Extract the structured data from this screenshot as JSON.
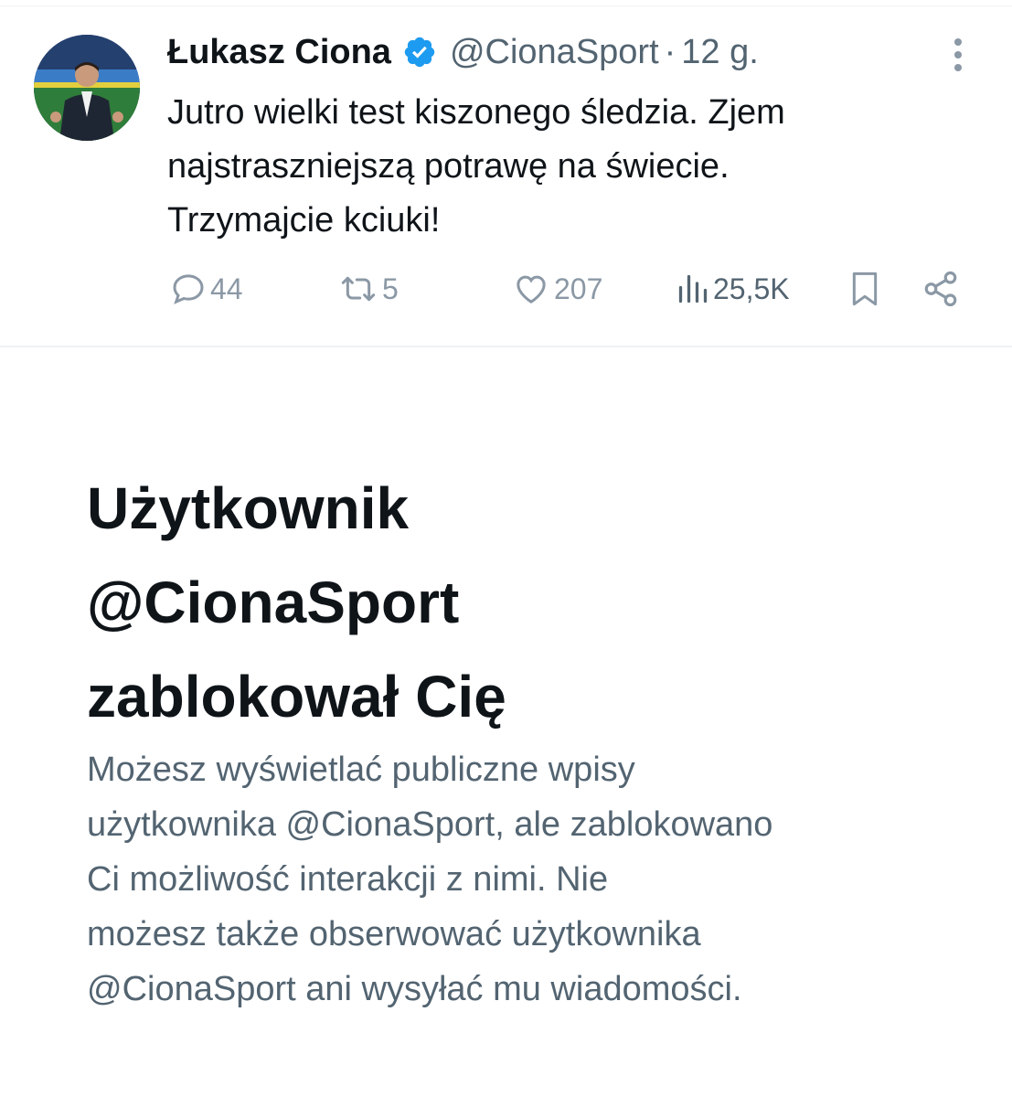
{
  "tweet": {
    "author_name": "Łukasz Ciona",
    "handle": "@CionaSport",
    "separator": "·",
    "time": "12 g.",
    "text_lines": [
      "Jutro wielki test kiszonego śledzia. Zjem",
      "najstraszniejszą potrawę na świecie.",
      "Trzymajcie kciuki!"
    ],
    "actions": {
      "replies": "44",
      "reposts": "5",
      "likes": "207",
      "views": "25,5K"
    },
    "icons": {
      "avatar": "avatar",
      "verified": "verified-badge-icon",
      "more": "more-vertical-icon",
      "reply": "reply-icon",
      "repost": "repost-icon",
      "like": "heart-icon",
      "views": "views-chart-icon",
      "bookmark": "bookmark-icon",
      "share": "share-icon"
    }
  },
  "blocked": {
    "title_lines": [
      "Użytkownik",
      "@CionaSport",
      "zablokował Cię"
    ],
    "description_lines": [
      "Możesz wyświetlać publiczne wpisy",
      "użytkownika @CionaSport, ale zablokowano",
      "Ci możliwość interakcji z nimi. Nie",
      "możesz także obserwować użytkownika",
      "@CionaSport ani wysyłać mu wiadomości."
    ]
  },
  "colors": {
    "text_primary": "#0f1419",
    "text_secondary": "#536471",
    "action_gray": "#8b98a5",
    "verified_blue": "#1d9bf0",
    "divider": "#eff3f4"
  }
}
